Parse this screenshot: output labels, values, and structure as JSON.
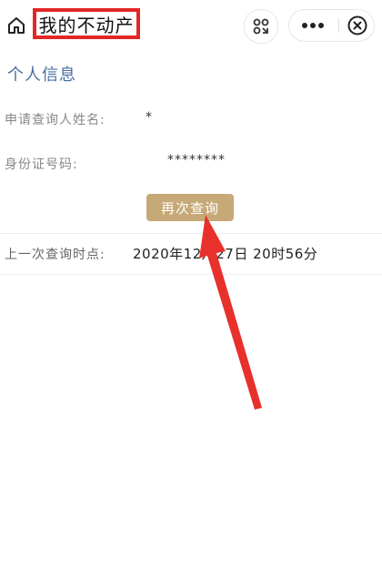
{
  "navbar": {
    "title": "我的不动产",
    "home_icon": "home-icon",
    "scan_icon": "scan-icon",
    "more_icon": "more-dots-icon",
    "close_icon": "close-circle-icon"
  },
  "personal_info": {
    "section_title": "个人信息",
    "applicant_label": "申请查询人姓名:",
    "applicant_value": "*",
    "id_label": "身份证号码:",
    "id_value": "********"
  },
  "actions": {
    "requery_label": "再次查询"
  },
  "last_query": {
    "label": "上一次查询时点:",
    "value": "2020年12月27日 20时56分"
  },
  "colors": {
    "title_border": "#e32626",
    "section_title": "#4a6fa5",
    "button_bg": "#c7a977",
    "annotation_arrow": "#e8302c"
  }
}
